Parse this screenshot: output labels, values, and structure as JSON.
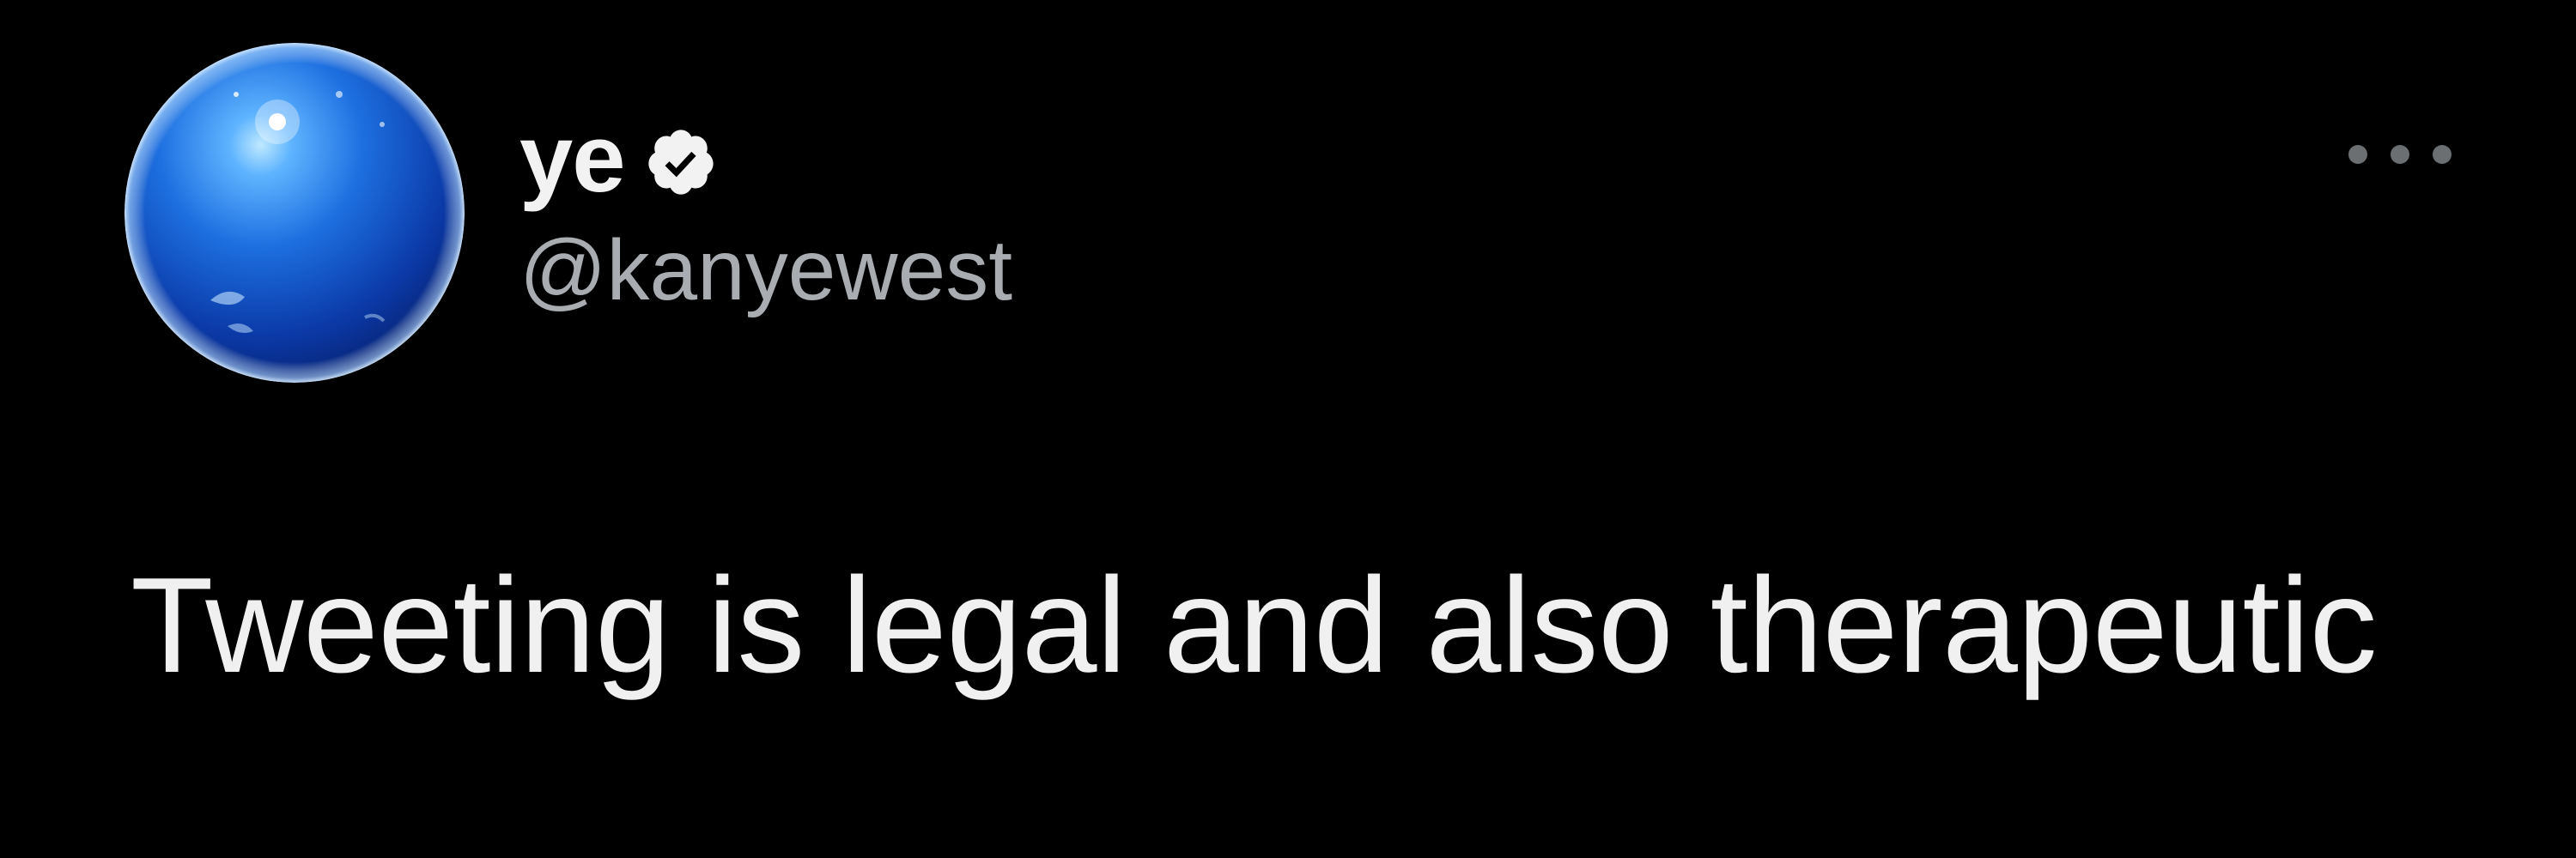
{
  "tweet": {
    "display_name": "ye",
    "handle": "@kanyewest",
    "verified": true,
    "text": "Tweeting is legal and also therapeutic",
    "avatar": {
      "icon": "blue-sphere-avatar",
      "colors": {
        "highlight": "#8fd6ff",
        "mid": "#1f6fd8",
        "dark": "#0a2a7a",
        "rim": "#d8ecff"
      }
    },
    "menu_icon": "more-horizontal-icon"
  },
  "theme": {
    "background": "#000000",
    "name_color": "#f2f2f2",
    "handle_color": "#a9adb1",
    "text_color": "#f0f0f0",
    "menu_dot_color": "#6c6f72",
    "verified_badge_color": "#f2f2f2"
  }
}
